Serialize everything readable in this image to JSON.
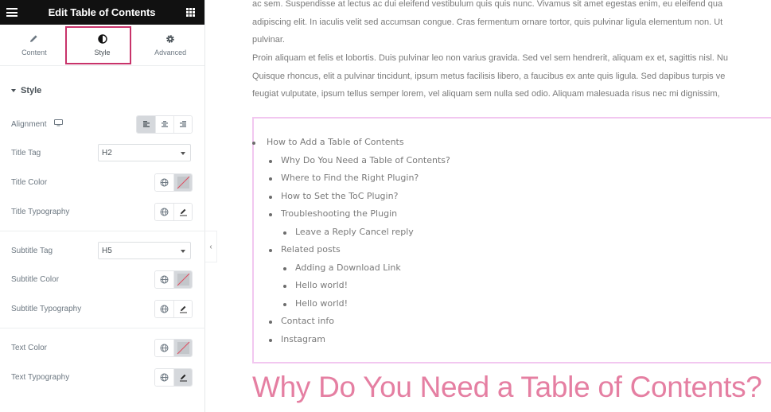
{
  "panel": {
    "title": "Edit Table of Contents",
    "menu_icon": "hamburger-icon",
    "apps_icon": "grid-icon",
    "tabs": [
      {
        "label": "Content",
        "icon": "pencil-icon",
        "active": false
      },
      {
        "label": "Style",
        "icon": "half-circle-icon",
        "active": true
      },
      {
        "label": "Advanced",
        "icon": "gear-icon",
        "active": false
      }
    ],
    "section_title": "Style",
    "controls": {
      "alignment": {
        "label": "Alignment",
        "device_icon": "desktop-icon",
        "options": [
          "left",
          "center",
          "right"
        ],
        "selected": "left"
      },
      "title_tag": {
        "label": "Title Tag",
        "value": "H2"
      },
      "title_color": {
        "label": "Title Color"
      },
      "title_typography": {
        "label": "Title Typography"
      },
      "subtitle_tag": {
        "label": "Subtitle Tag",
        "value": "H5"
      },
      "subtitle_color": {
        "label": "Subtitle Color"
      },
      "subtitle_typography": {
        "label": "Subtitle Typography"
      },
      "text_color": {
        "label": "Text Color"
      },
      "text_typography": {
        "label": "Text Typography"
      }
    }
  },
  "preview": {
    "paragraph_lines": [
      "ac sem. Suspendisse at lectus ac dui eleifend vestibulum quis quis nunc. Vivamus sit amet egestas enim, eu eleifend qua",
      "adipiscing elit. In iaculis velit sed accumsan congue. Cras fermentum ornare tortor, quis pulvinar ligula elementum non. Ut",
      "pulvinar.",
      "Proin aliquam et felis et lobortis. Duis pulvinar leo non varius gravida. Sed vel sem hendrerit, aliquam ex et, sagittis nisl. Nu",
      "Quisque rhoncus, elit a pulvinar tincidunt, ipsum metus facilisis libero, a faucibus ex ante quis ligula. Sed dapibus turpis ve",
      "feugiat vulputate, ipsum tellus semper lorem, vel aliquam sem nulla sed odio. Aliquam malesuada risus nec mi dignissim,"
    ],
    "toc": [
      {
        "text": "How to Add a Table of Contents",
        "level": 0
      },
      {
        "text": "Why Do You Need a Table of Contents?",
        "level": 1
      },
      {
        "text": "Where to Find the Right Plugin?",
        "level": 1
      },
      {
        "text": "How to Set the ToC Plugin?",
        "level": 1
      },
      {
        "text": "Troubleshooting the Plugin",
        "level": 1
      },
      {
        "text": "Leave a Reply Cancel reply",
        "level": 2
      },
      {
        "text": "Related posts",
        "level": 1
      },
      {
        "text": "Adding a Download Link",
        "level": 2
      },
      {
        "text": "Hello world!",
        "level": 2
      },
      {
        "text": "Hello world!",
        "level": 2
      },
      {
        "text": "Contact info",
        "level": 1
      },
      {
        "text": "Instagram",
        "level": 1
      }
    ],
    "heading": "Why Do You Need a Table of Contents?",
    "colors": {
      "heading": "#e57fa2",
      "toc_border": "#f2c7f0",
      "highlight": "#c8336a"
    }
  }
}
